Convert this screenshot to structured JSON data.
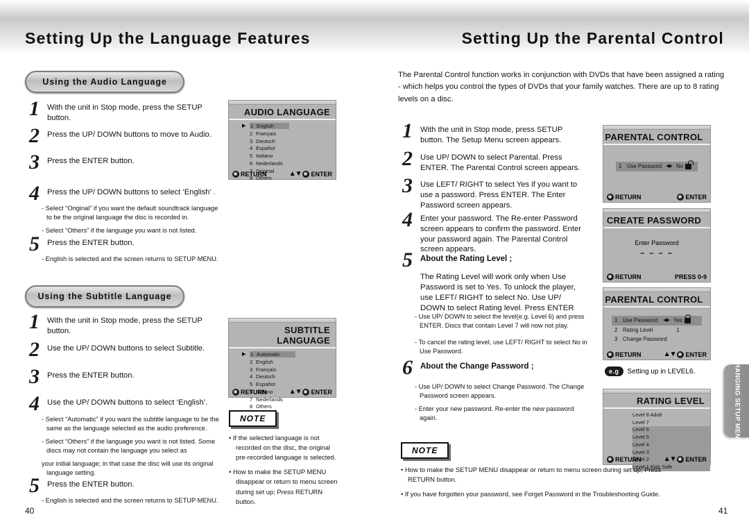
{
  "left_page": {
    "header_title": "Setting Up the Language Features",
    "page_number": "40",
    "sections": [
      {
        "pill_label": "Using the Audio Language",
        "steps": [
          {
            "num": "1",
            "text": "With the unit in Stop mode, press the SETUP button."
          },
          {
            "num": "2",
            "text": "Press the UP/ DOWN buttons to move to Audio."
          },
          {
            "num": "3",
            "text": "Press the ENTER button."
          },
          {
            "num": "4",
            "text": "Press the UP/ DOWN buttons to select ‘English’ ."
          },
          {
            "num": "5",
            "text": "Press the ENTER button."
          }
        ],
        "notes_after_4": [
          "- Select “Original” if you want the default soundtrack language to be the original language the disc is recorded in.",
          "- Select “Others” if the language you want is not listed."
        ],
        "notes_after_5": [
          "- English is selected and the screen returns to SETUP MENU."
        ]
      },
      {
        "pill_label": "Using the Subtitle Language",
        "steps": [
          {
            "num": "1",
            "text": "With the unit in Stop mode, press the SETUP button."
          },
          {
            "num": "2",
            "text": "Use the UP/ DOWN buttons to select Subtitle."
          },
          {
            "num": "3",
            "text": "Press the ENTER button."
          },
          {
            "num": "4",
            "text": "Use the UP/ DOWN buttons to select ‘English’."
          },
          {
            "num": "5",
            "text": "Press the ENTER button."
          }
        ],
        "notes_after_4": [
          "- Select “Automatic” if you want the subtitle language to be the same as the language selected as the audio preference.",
          "- Select “Others” if the language you want is not listed. Some discs may not contain the language you  select as",
          "your initial language; in that case the disc will use its original language setting."
        ],
        "notes_after_5": [
          "- English is selected and the screen returns to SETUP MENU."
        ]
      }
    ],
    "audio_screen": {
      "title": "AUDIO LANGUAGE",
      "items": [
        {
          "n": "1",
          "label": "English",
          "selected": true
        },
        {
          "n": "2",
          "label": "Français",
          "selected": false
        },
        {
          "n": "3",
          "label": "Deutsch",
          "selected": false
        },
        {
          "n": "4",
          "label": "Español",
          "selected": false
        },
        {
          "n": "5",
          "label": "Italiano",
          "selected": false
        },
        {
          "n": "6",
          "label": "Nederlands",
          "selected": false
        },
        {
          "n": "7",
          "label": "Original",
          "selected": false
        },
        {
          "n": "8",
          "label": "Others",
          "selected": false
        }
      ],
      "return_label": "RETURN",
      "enter_label": "ENTER"
    },
    "subtitle_screen": {
      "title": "SUBTITLE LANGUAGE",
      "items": [
        {
          "n": "1",
          "label": "Automatic",
          "selected": true
        },
        {
          "n": "2",
          "label": "English",
          "selected": false
        },
        {
          "n": "3",
          "label": "Français",
          "selected": false
        },
        {
          "n": "4",
          "label": "Deutsch",
          "selected": false
        },
        {
          "n": "5",
          "label": "Español",
          "selected": false
        },
        {
          "n": "6",
          "label": "Italiano",
          "selected": false
        },
        {
          "n": "7",
          "label": "Nederlands",
          "selected": false
        },
        {
          "n": "8",
          "label": "Others",
          "selected": false
        }
      ],
      "return_label": "RETURN",
      "enter_label": "ENTER"
    },
    "note": {
      "label": "NOTE",
      "bullets": [
        "• If the selected language is not recorded on the disc, the original pre-recorded language is selected.",
        "• How to make the SETUP MENU disappear or return to menu screen during set up; Press RETURN button."
      ]
    }
  },
  "right_page": {
    "header_title": "Setting Up the Parental Control",
    "page_number": "41",
    "intro": "The Parental Control function works in conjunction with DVDs that have been assigned a rating - which helps you control the types of DVDs that your family watches. There are up to 8 rating levels on a disc.",
    "steps": [
      {
        "num": "1",
        "text": "With the unit in Stop mode, press SETUP button. The Setup Menu screen appears."
      },
      {
        "num": "2",
        "text": "Use UP/ DOWN to select Parental. Press ENTER. The Parental Control screen appears."
      },
      {
        "num": "3",
        "text": "Use LEFT/ RIGHT to select Yes if you want to use a password. Press ENTER. The Enter Password screen appears."
      },
      {
        "num": "4",
        "text": "Enter your password. The Re-enter Password screen appears to confirm the password. Enter your password again. The Parental Control screen appears."
      },
      {
        "num": "5",
        "heading": "About the Rating Level ;",
        "text": "The Rating Level will work only when Use Password is set to Yes. To unlock the player, use LEFT/ RIGHT to select No. Use UP/ DOWN to select Rating level. Press ENTER"
      },
      {
        "num": "6",
        "heading": "About the Change Password ;",
        "text": ""
      }
    ],
    "rating_notes": [
      "- Use UP/ DOWN to select the level(e.g. Level 6) and press ENTER. Discs that contain Level 7 will now not play.",
      "- To cancel the rating level, use LEFT/ RIGHT to select No in Use Password."
    ],
    "change_pw_notes": [
      "- Use UP/ DOWN to select Change Password. The Change Password screen appears.",
      "- Enter your new password. Re-enter the new password again."
    ],
    "parental_screen_1": {
      "title": "PARENTAL CONTROL",
      "row_index": "1",
      "row_label": "Use Password",
      "arrows": "◀▶",
      "value": "No",
      "lock_state": "unlocked",
      "return_label": "RETURN",
      "enter_label": "ENTER"
    },
    "create_password_screen": {
      "title": "CREATE PASSWORD",
      "prompt": "Enter Password",
      "mask": "–  –  –  –",
      "return_label": "RETURN",
      "press_label": "PRESS 0-9"
    },
    "parental_screen_2": {
      "title": "PARENTAL CONTROL",
      "rows": [
        {
          "n": "1",
          "label": "Use Password",
          "arrows": "◀▶",
          "value": "Yes",
          "lock": "locked",
          "selected": true
        },
        {
          "n": "2",
          "label": "Rating Level",
          "arrows": "",
          "value": "1",
          "lock": "",
          "selected": false
        },
        {
          "n": "3",
          "label": "Change Password",
          "arrows": "",
          "value": "",
          "lock": "",
          "selected": false
        }
      ],
      "return_label": "RETURN",
      "enter_label": "ENTER"
    },
    "example": {
      "badge": "e.g",
      "text": "Setting up in LEVEL6."
    },
    "rating_level_screen": {
      "title": "RATING LEVEL",
      "items": [
        {
          "label": "Level 8 Adult",
          "highlighted": false
        },
        {
          "label": "Level 7",
          "highlighted": false
        },
        {
          "label": "Level 6",
          "highlighted": true
        },
        {
          "label": "Level 5",
          "highlighted": true
        },
        {
          "label": "Level 4",
          "highlighted": true
        },
        {
          "label": "Level 3",
          "highlighted": true
        },
        {
          "label": "Level 2",
          "highlighted": true
        },
        {
          "label": "Level 1 Kids Safe",
          "highlighted": true
        }
      ],
      "return_label": "RETURN",
      "enter_label": "ENTER"
    },
    "note": {
      "label": "NOTE",
      "bullets": [
        "• How to make the SETUP MENU disappear or return to menu screen during set up; Press RETURN button.",
        "• If you have forgotten your password, see Forget Password in the Troubleshooting Guide."
      ]
    },
    "side_tab": "CHANGING SETUP MENU"
  }
}
